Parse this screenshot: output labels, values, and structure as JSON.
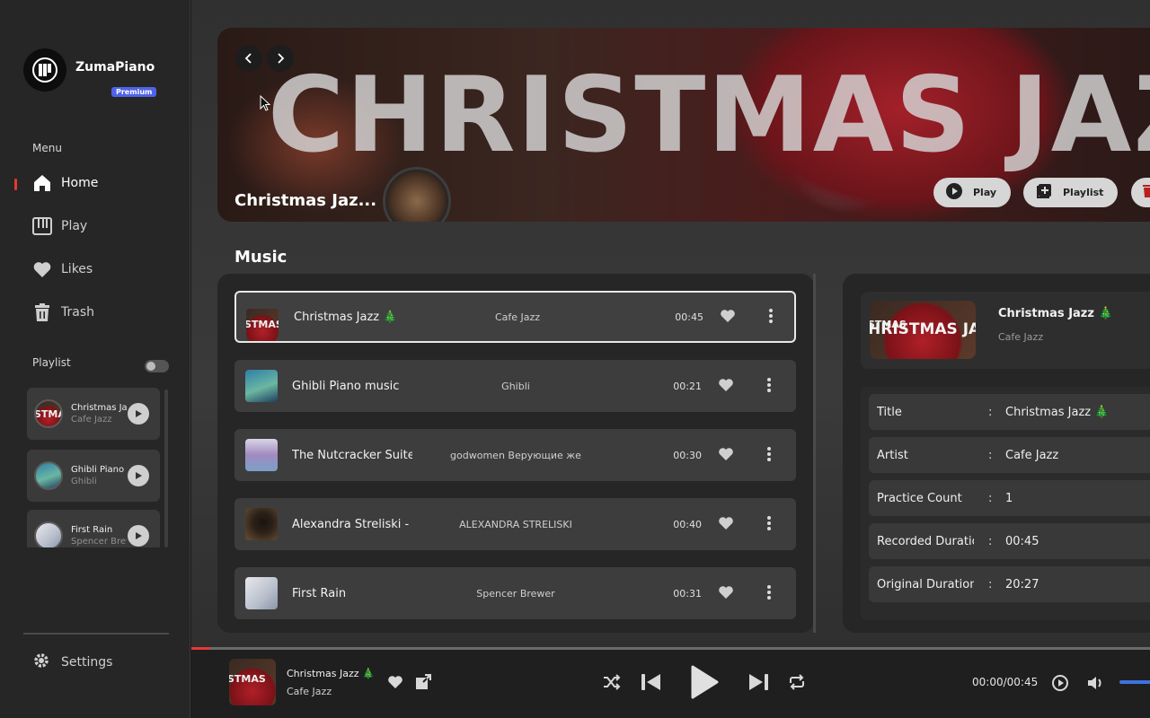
{
  "app": {
    "name": "ZumaPiano",
    "badge": "Premium"
  },
  "sidebar": {
    "menu_label": "Menu",
    "items": [
      {
        "label": "Home",
        "icon": "home-icon",
        "active": true
      },
      {
        "label": "Play",
        "icon": "piano-icon"
      },
      {
        "label": "Likes",
        "icon": "heart-icon"
      },
      {
        "label": "Trash",
        "icon": "trash-icon"
      }
    ],
    "playlist_label": "Playlist",
    "playlists": [
      {
        "title": "Christmas Jazz",
        "subtitle": "Cafe Jazz"
      },
      {
        "title": "Ghibli Piano music",
        "subtitle": "Ghibli"
      },
      {
        "title": "First Rain",
        "subtitle": "Spencer Brewer"
      }
    ],
    "settings_label": "Settings"
  },
  "banner": {
    "big_text": "CHRISTMAS JAZZ",
    "title": "Christmas Jaz...",
    "play_label": "Play",
    "playlist_label": "Playlist"
  },
  "music": {
    "section_title": "Music",
    "rows": [
      {
        "title": "Christmas Jazz 🎄",
        "artist": "Cafe Jazz",
        "duration": "00:45",
        "selected": true
      },
      {
        "title": "Ghibli Piano music",
        "artist": "Ghibli",
        "duration": "00:21"
      },
      {
        "title": "The Nutcracker Suite",
        "artist": "godwomen Верующие же",
        "duration": "00:30"
      },
      {
        "title": "Alexandra Streliski - I",
        "artist": "ALEXANDRA STRELISKI",
        "duration": "00:40"
      },
      {
        "title": "First Rain",
        "artist": "Spencer Brewer",
        "duration": "00:31"
      }
    ]
  },
  "detail": {
    "title": "Christmas Jazz 🎄",
    "subtitle": "Cafe Jazz",
    "thumb_text": "HRISTMAS JA",
    "fields": [
      {
        "key": "Title",
        "value": "Christmas Jazz 🎄"
      },
      {
        "key": "Artist",
        "value": "Cafe Jazz"
      },
      {
        "key": "Practice Count",
        "value": "1"
      },
      {
        "key": "Recorded Duration",
        "value": "00:45"
      },
      {
        "key": "Original Duration",
        "value": "20:27"
      }
    ]
  },
  "player": {
    "title": "Christmas Jazz 🎄",
    "artist": "Cafe Jazz",
    "time": "00:00/00:45",
    "progress": 0.0
  },
  "colors": {
    "accent_red": "#e53935",
    "premium_blue": "#4f63e9",
    "volume_blue": "#3b73e0"
  }
}
